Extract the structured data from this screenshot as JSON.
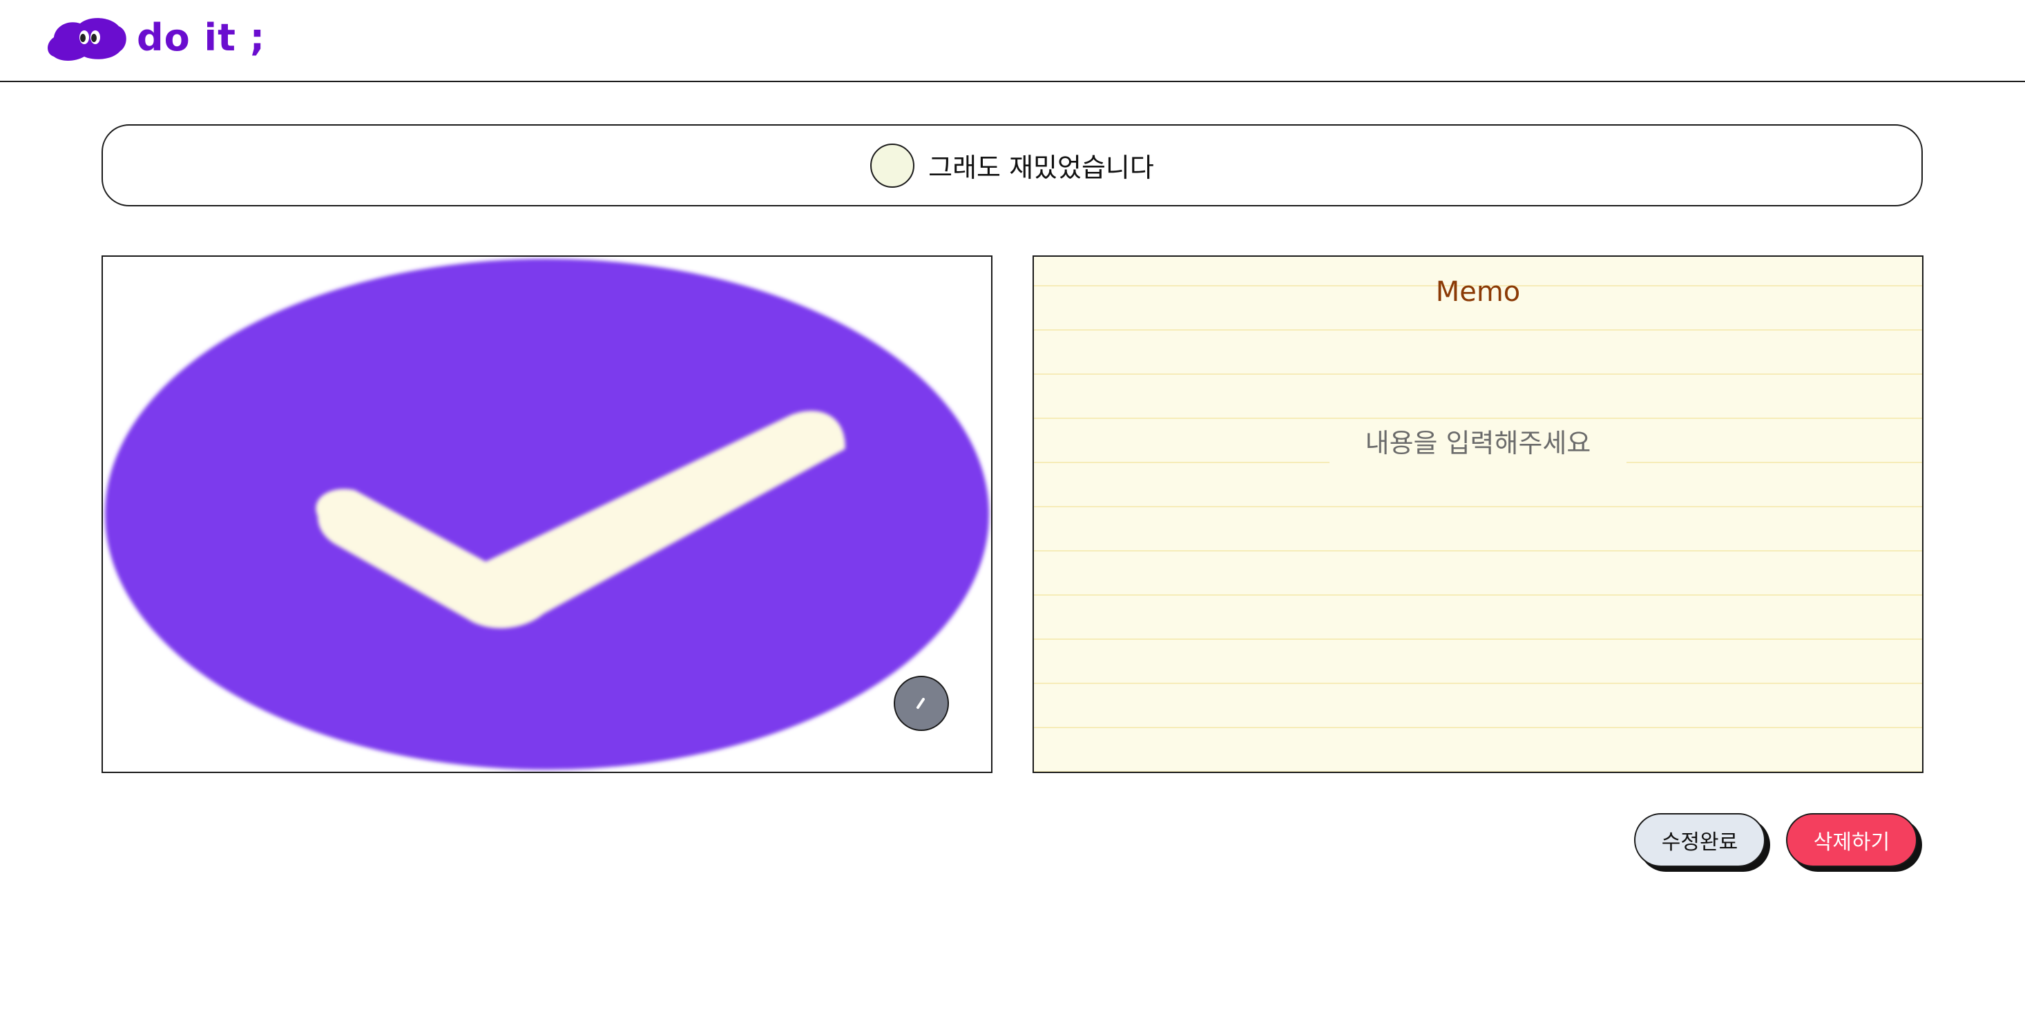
{
  "header": {
    "logo_text": "do it ;",
    "logo_icon": "cloud-eyes-logo-icon",
    "brand_color": "#6a0dcf"
  },
  "task": {
    "title": "그래도 재밌었습니다",
    "completed": false,
    "check_fill_color": "#f4f7e0"
  },
  "image": {
    "icon": "check-circle-image",
    "primary_color": "#7c3aed",
    "check_color": "#fdf9e3",
    "edit_icon": "pencil-icon"
  },
  "memo": {
    "title": "Memo",
    "placeholder": "내용을 입력해주세요",
    "value": ""
  },
  "actions": {
    "save_label": "수정완료",
    "delete_label": "삭제하기",
    "save_color": "#e2e8f0",
    "delete_color": "#f43f5e"
  }
}
